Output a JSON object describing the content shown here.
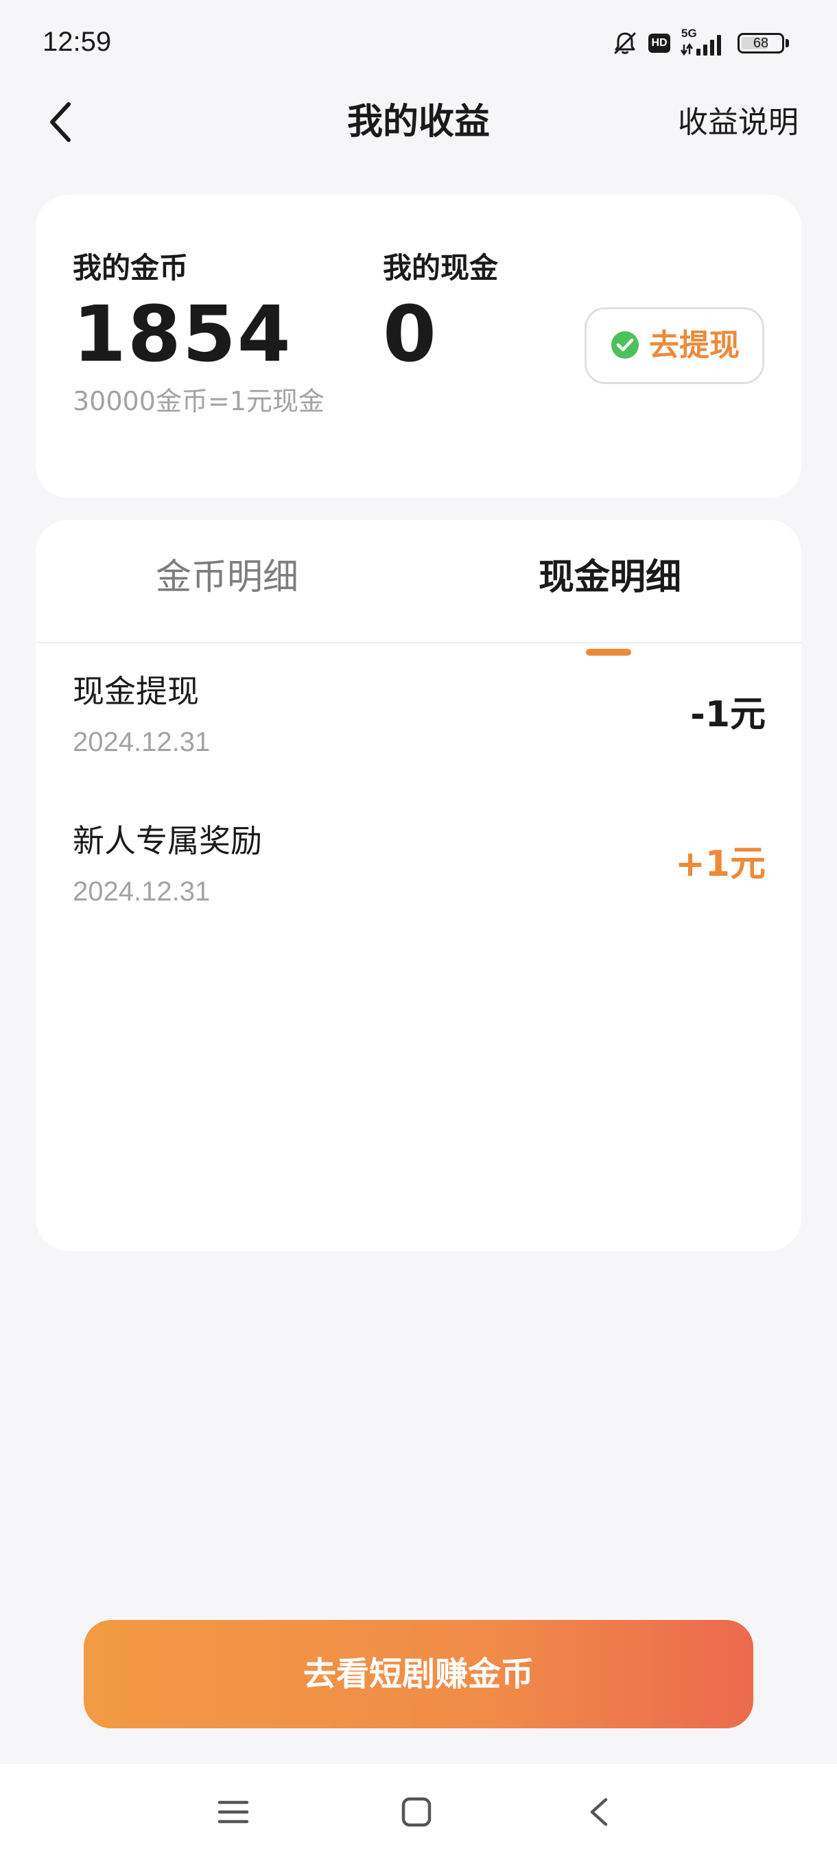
{
  "status_bar": {
    "time": "12:59",
    "network": "5G",
    "hd_label": "HD",
    "battery": "68",
    "battery_level_pct": 68,
    "icons": [
      "bell-off-icon",
      "hd-icon",
      "signal-icon",
      "battery-icon"
    ]
  },
  "header": {
    "title": "我的收益",
    "help_label": "收益说明",
    "back_icon": "chevron-left-icon"
  },
  "balance": {
    "coins_label": "我的金币",
    "coins_value": "1854",
    "rate_note": "30000金币=1元现金",
    "cash_label": "我的现金",
    "cash_value": "0",
    "withdraw_label": "去提现",
    "withdraw_icon": "wechat-icon"
  },
  "tabs": [
    {
      "label": "金币明细",
      "active": false
    },
    {
      "label": "现金明细",
      "active": true
    }
  ],
  "records": [
    {
      "title": "现金提现",
      "date": "2024.12.31",
      "amount": "-1元",
      "positive": false
    },
    {
      "title": "新人专属奖励",
      "date": "2024.12.31",
      "amount": "+1元",
      "positive": true
    }
  ],
  "cta": {
    "label": "去看短剧赚金币"
  },
  "nav": {
    "icons": [
      "menu-icon",
      "home-icon",
      "back-icon"
    ]
  },
  "colors": {
    "accent": "#ec8a3a",
    "background": "#f6f6f8",
    "card": "#ffffff",
    "wechat_green": "#4cc05b"
  }
}
